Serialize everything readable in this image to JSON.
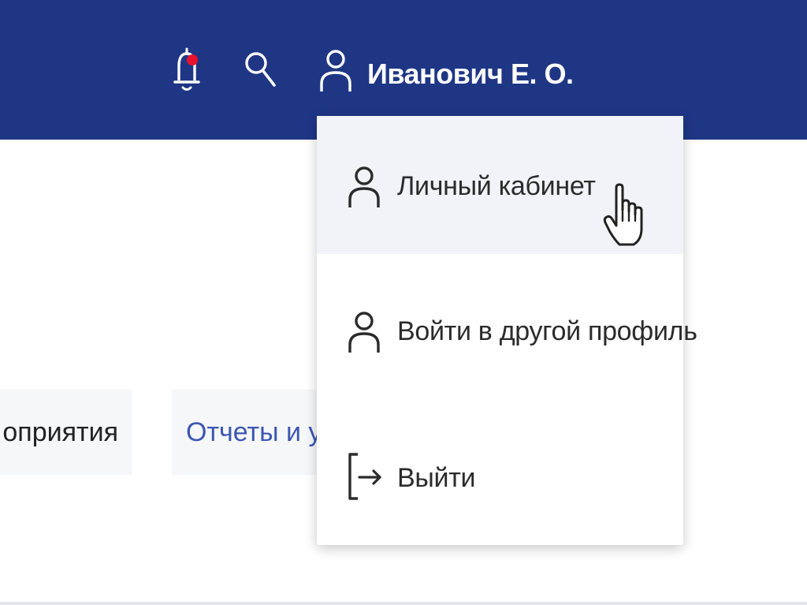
{
  "header": {
    "background_color": "#1f3685",
    "notification_icon": "bell-icon",
    "notification_dot_color": "#e8112d",
    "search_icon": "search-icon",
    "user_icon": "user-icon",
    "user_name": "Иванович Е. О."
  },
  "tabs": [
    {
      "label": "оприятия"
    },
    {
      "label": "Отчеты и у"
    }
  ],
  "dropdown": {
    "items": [
      {
        "icon": "user-icon",
        "label": "Личный кабинет",
        "highlighted": true
      },
      {
        "icon": "user-icon",
        "label": "Войти в другой профиль",
        "highlighted": false
      },
      {
        "icon": "logout-icon",
        "label": "Выйти",
        "highlighted": false
      }
    ]
  },
  "cursor": "hand-pointer-icon"
}
